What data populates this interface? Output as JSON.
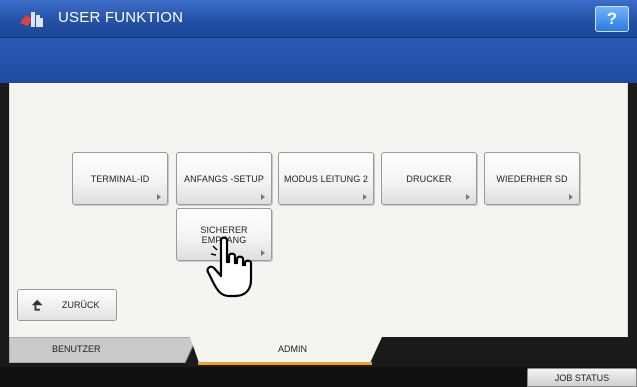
{
  "header": {
    "title": "USER FUNKTION",
    "help_label": "?"
  },
  "functions": [
    {
      "label": "TERMINAL-ID"
    },
    {
      "label": "ANFANGS -SETUP"
    },
    {
      "label": "MODUS LEITUNG 2"
    },
    {
      "label": "DRUCKER"
    },
    {
      "label": "WIEDERHER SD"
    },
    {
      "label": "SICHERER EMPFANG"
    }
  ],
  "back_button": {
    "label": "ZURÜCK"
  },
  "tabs": [
    {
      "label": "BENUTZER",
      "active": false
    },
    {
      "label": "ADMIN",
      "active": true
    }
  ],
  "footer": {
    "job_status_label": "JOB STATUS"
  },
  "colors": {
    "title_bar": "#2552a8",
    "panel_bg": "#f4f4f1",
    "active_tab_underline": "#f0a020"
  }
}
